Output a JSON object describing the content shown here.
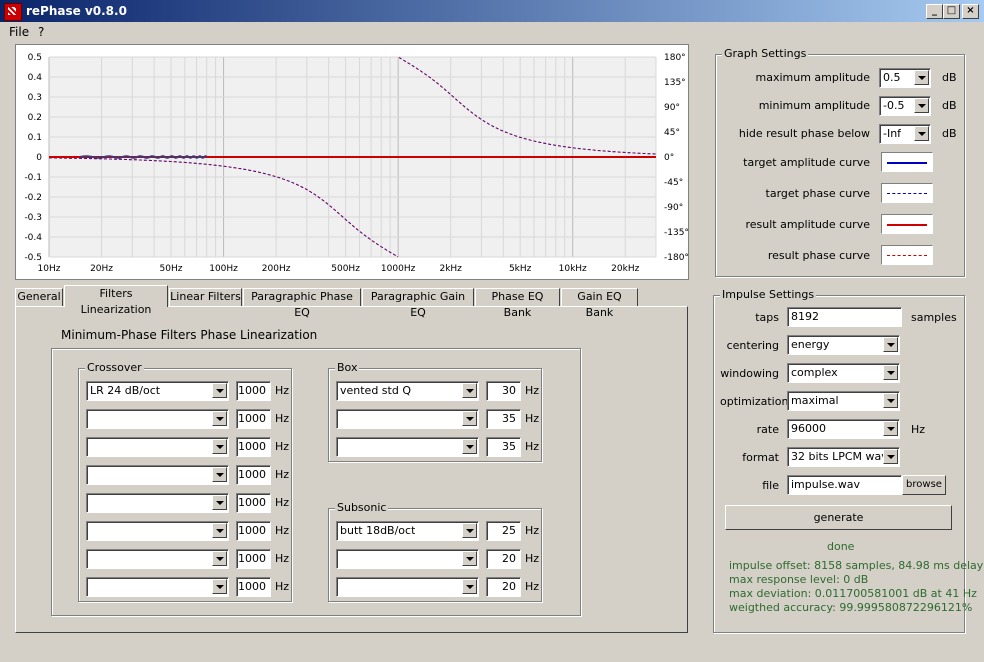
{
  "window": {
    "title": "rePhase v0.8.0"
  },
  "menu": {
    "file": "File",
    "help": "?"
  },
  "graph": {
    "y_left_ticks": [
      "0.5",
      "0.4",
      "0.3",
      "0.2",
      "0.1",
      "0",
      "-0.1",
      "-0.2",
      "-0.3",
      "-0.4",
      "-0.5"
    ],
    "y_right_ticks": [
      "180°",
      "135°",
      "90°",
      "45°",
      "0°",
      "-45°",
      "-90°",
      "-135°",
      "-180°"
    ],
    "x_ticks": [
      "10Hz",
      "20Hz",
      "50Hz",
      "100Hz",
      "200Hz",
      "500Hz",
      "1000Hz",
      "2kHz",
      "5kHz",
      "10kHz",
      "20kHz"
    ],
    "colors": {
      "target_amplitude": "#0000c0",
      "target_phase": "#0000c0",
      "result_amplitude": "#cc0000",
      "result_phase": "#cc0000"
    }
  },
  "graph_settings": {
    "title": "Graph Settings",
    "max_amp": {
      "label": "maximum amplitude",
      "value": "0.5",
      "unit": "dB"
    },
    "min_amp": {
      "label": "minimum amplitude",
      "value": "-0.5",
      "unit": "dB"
    },
    "hide_phase": {
      "label": "hide result phase below",
      "value": "-Inf",
      "unit": "dB"
    },
    "target_amp_curve": "target amplitude curve",
    "target_phase_curve": "target phase curve",
    "result_amp_curve": "result amplitude curve",
    "result_phase_curve": "result phase curve"
  },
  "impulse_settings": {
    "title": "Impulse Settings",
    "taps": {
      "label": "taps",
      "value": "8192",
      "unit": "samples"
    },
    "centering": {
      "label": "centering",
      "value": "energy"
    },
    "windowing": {
      "label": "windowing",
      "value": "complex"
    },
    "optimization": {
      "label": "optimization",
      "value": "maximal"
    },
    "rate": {
      "label": "rate",
      "value": "96000",
      "unit": "Hz"
    },
    "format": {
      "label": "format",
      "value": "32 bits LPCM wav"
    },
    "file": {
      "label": "file",
      "value": "impulse.wav",
      "browse": "browse"
    },
    "generate": "generate",
    "done": "done",
    "status": [
      "impulse offset: 8158 samples, 84.98 ms delay",
      "max response level: 0 dB",
      "max deviation: 0.011700581001 dB at 41 Hz",
      "weigthed accuracy: 99.9995808722961​21%"
    ]
  },
  "tabs": [
    "General",
    "Filters Linearization",
    "Linear Filters",
    "Paragraphic Phase EQ",
    "Paragraphic Gain EQ",
    "Phase EQ Bank",
    "Gain EQ Bank"
  ],
  "panel": {
    "heading": "Minimum-Phase Filters Phase Linearization",
    "hz": "Hz",
    "crossover": {
      "title": "Crossover",
      "rows": [
        {
          "type": "LR  24 dB/oct",
          "freq": "1000"
        },
        {
          "type": "",
          "freq": "1000"
        },
        {
          "type": "",
          "freq": "1000"
        },
        {
          "type": "",
          "freq": "1000"
        },
        {
          "type": "",
          "freq": "1000"
        },
        {
          "type": "",
          "freq": "1000"
        },
        {
          "type": "",
          "freq": "1000"
        },
        {
          "type": "",
          "freq": "1000"
        }
      ]
    },
    "box": {
      "title": "Box",
      "rows": [
        {
          "type": "vented std Q",
          "freq": "30"
        },
        {
          "type": "",
          "freq": "35"
        },
        {
          "type": "",
          "freq": "35"
        }
      ]
    },
    "subsonic": {
      "title": "Subsonic",
      "rows": [
        {
          "type": "butt 18dB/oct",
          "freq": "25"
        },
        {
          "type": "",
          "freq": "20"
        },
        {
          "type": "",
          "freq": "20"
        }
      ]
    }
  }
}
